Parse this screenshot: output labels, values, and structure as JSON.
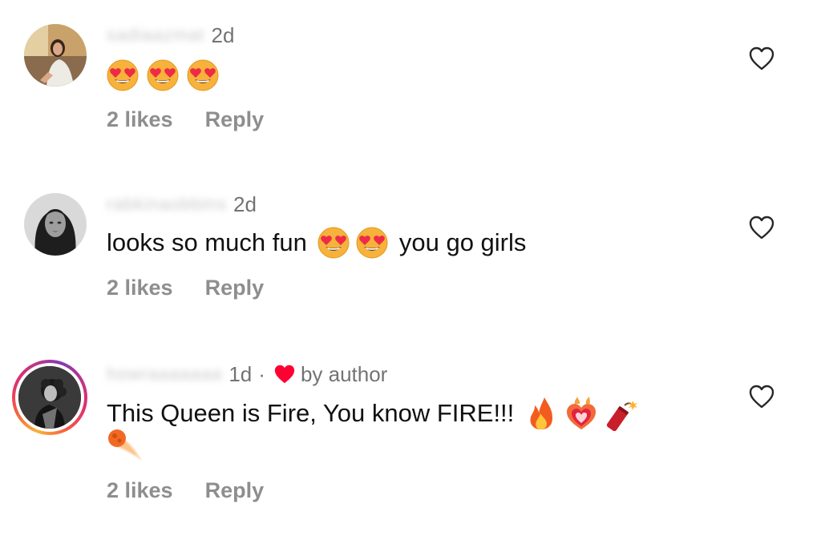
{
  "comments": [
    {
      "username": "sadiaazmat",
      "time": "2d",
      "text": "",
      "emoji": [
        "heart-eyes",
        "heart-eyes",
        "heart-eyes"
      ],
      "likes": "2 likes",
      "reply": "Reply"
    },
    {
      "username": "rabkinaobbins",
      "time": "2d",
      "text_before": "looks so much fun",
      "emoji": [
        "heart-eyes",
        "heart-eyes"
      ],
      "text_after": "you go girls",
      "likes": "2 likes",
      "reply": "Reply"
    },
    {
      "username": "howraaaaaaa",
      "time": "1d",
      "separator": "·",
      "author_badge": "by author",
      "text": "This Queen is Fire, You know FIRE!!!",
      "emoji": [
        "fire",
        "heart-on-fire",
        "firecracker",
        "comet"
      ],
      "likes": "2 likes",
      "reply": "Reply"
    }
  ],
  "colors": {
    "meta_text": "#737373",
    "action_text": "#8e8e8e",
    "author_heart": "#ff0033",
    "story_ring": [
      "#f9b23b",
      "#e1306c",
      "#833ab4"
    ]
  }
}
